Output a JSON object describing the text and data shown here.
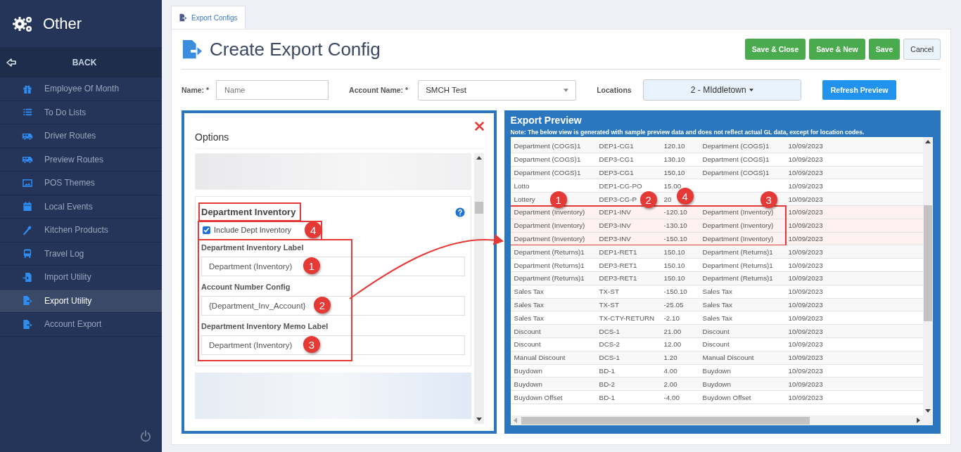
{
  "sidebar": {
    "title": "Other",
    "back": "BACK",
    "items": [
      {
        "label": "Employee Of Month",
        "selected": false
      },
      {
        "label": "To Do Lists",
        "selected": false
      },
      {
        "label": "Driver Routes",
        "selected": false
      },
      {
        "label": "Preview Routes",
        "selected": false
      },
      {
        "label": "POS Themes",
        "selected": false
      },
      {
        "label": "Local Events",
        "selected": false
      },
      {
        "label": "Kitchen Products",
        "selected": false
      },
      {
        "label": "Travel Log",
        "selected": false
      },
      {
        "label": "Import Utility",
        "selected": false
      },
      {
        "label": "Export Utility",
        "selected": true
      },
      {
        "label": "Account Export",
        "selected": false
      }
    ]
  },
  "tabs": [
    {
      "label": "Export Configs"
    }
  ],
  "page_title": "Create Export Config",
  "buttons": [
    {
      "label": "Save & Close",
      "kind": "success"
    },
    {
      "label": "Save & New",
      "kind": "success"
    },
    {
      "label": "Save",
      "kind": "success"
    },
    {
      "label": "Cancel",
      "kind": "default"
    }
  ],
  "form": {
    "name_label": "Name: *",
    "name_placeholder": "Name",
    "account_label": "Account Name: *",
    "account_value": "SMCH Test",
    "locations_label": "Locations",
    "locations_value": "2 - MIddletown",
    "refresh_button": "Refresh Preview"
  },
  "options": {
    "title": "Options",
    "section_title": "Department Inventory",
    "checkbox": {
      "label": "Include Dept Inventory",
      "checked": true,
      "callout": "4"
    },
    "fields": [
      {
        "label": "Department Inventory Label",
        "value": "Department (Inventory)",
        "callout": "1"
      },
      {
        "label": "Account Number Config",
        "value": "{Department_Inv_Account}",
        "callout": "2"
      },
      {
        "label": "Department Inventory Memo Label",
        "value": "Department (Inventory)",
        "callout": "3"
      }
    ]
  },
  "preview": {
    "title": "Export Preview",
    "note": "**Note**: The below view is generated with sample preview data and does not reflect actual GL data, except for location codes.",
    "callouts": [
      "1",
      "2",
      "4",
      "3"
    ],
    "rows": [
      {
        "cells": [
          "Department (COGS)1",
          "DEP1-CG1",
          "120.10",
          "Department (COGS)1",
          "10/09/2023"
        ],
        "highlighted": false
      },
      {
        "cells": [
          "Department (COGS)1",
          "DEP3-CG1",
          "130.10",
          "Department (COGS)1",
          "10/09/2023"
        ],
        "highlighted": false
      },
      {
        "cells": [
          "Department (COGS)1",
          "DEP3-CG1",
          "150.10",
          "Department (COGS)1",
          "10/09/2023"
        ],
        "highlighted": false
      },
      {
        "cells": [
          "Lotto",
          "DEP1-CG-PO",
          "15.00",
          "",
          "10/09/2023"
        ],
        "highlighted": false
      },
      {
        "cells": [
          "Lottery",
          "DEP3-CG-P",
          "20",
          "",
          "10/09/2023"
        ],
        "highlighted": false
      },
      {
        "cells": [
          "Department (Inventory)",
          "DEP1-INV",
          "-120.10",
          "Department (Inventory)",
          "10/09/2023"
        ],
        "highlighted": true
      },
      {
        "cells": [
          "Department (Inventory)",
          "DEP3-INV",
          "-130.10",
          "Department (Inventory)",
          "10/09/2023"
        ],
        "highlighted": true
      },
      {
        "cells": [
          "Department (Inventory)",
          "DEP3-INV",
          "-150.10",
          "Department (Inventory)",
          "10/09/2023"
        ],
        "highlighted": true
      },
      {
        "cells": [
          "Department (Returns)1",
          "DEP1-RET1",
          "150.10",
          "Department (Returns)1",
          "10/09/2023"
        ],
        "highlighted": false
      },
      {
        "cells": [
          "Department (Returns)1",
          "DEP3-RET1",
          "150.10",
          "Department (Returns)1",
          "10/09/2023"
        ],
        "highlighted": false
      },
      {
        "cells": [
          "Department (Returns)1",
          "DEP3-RET1",
          "150.10",
          "Department (Returns)1",
          "10/09/2023"
        ],
        "highlighted": false
      },
      {
        "cells": [
          "Sales Tax",
          "TX-ST",
          "-150.10",
          "Sales Tax",
          "10/09/2023"
        ],
        "highlighted": false
      },
      {
        "cells": [
          "Sales Tax",
          "TX-ST",
          "-25.05",
          "Sales Tax",
          "10/09/2023"
        ],
        "highlighted": false
      },
      {
        "cells": [
          "Sales Tax",
          "TX-CTY-RETURN",
          "-2.10",
          "Sales Tax",
          "10/09/2023"
        ],
        "highlighted": false
      },
      {
        "cells": [
          "Discount",
          "DCS-1",
          "21.00",
          "Discount",
          "10/09/2023"
        ],
        "highlighted": false
      },
      {
        "cells": [
          "Discount",
          "DCS-2",
          "12.00",
          "Discount",
          "10/09/2023"
        ],
        "highlighted": false
      },
      {
        "cells": [
          "Manual Discount",
          "DCS-1",
          "1.20",
          "Manual Discount",
          "10/09/2023"
        ],
        "highlighted": false
      },
      {
        "cells": [
          "Buydown",
          "BD-1",
          "4.00",
          "Buydown",
          "10/09/2023"
        ],
        "highlighted": false
      },
      {
        "cells": [
          "Buydown",
          "BD-2",
          "2.00",
          "Buydown",
          "10/09/2023"
        ],
        "highlighted": false
      },
      {
        "cells": [
          "Buydown Offset",
          "BD-1",
          "-4.00",
          "Buydown Offset",
          "10/09/2023"
        ],
        "highlighted": false
      }
    ]
  }
}
